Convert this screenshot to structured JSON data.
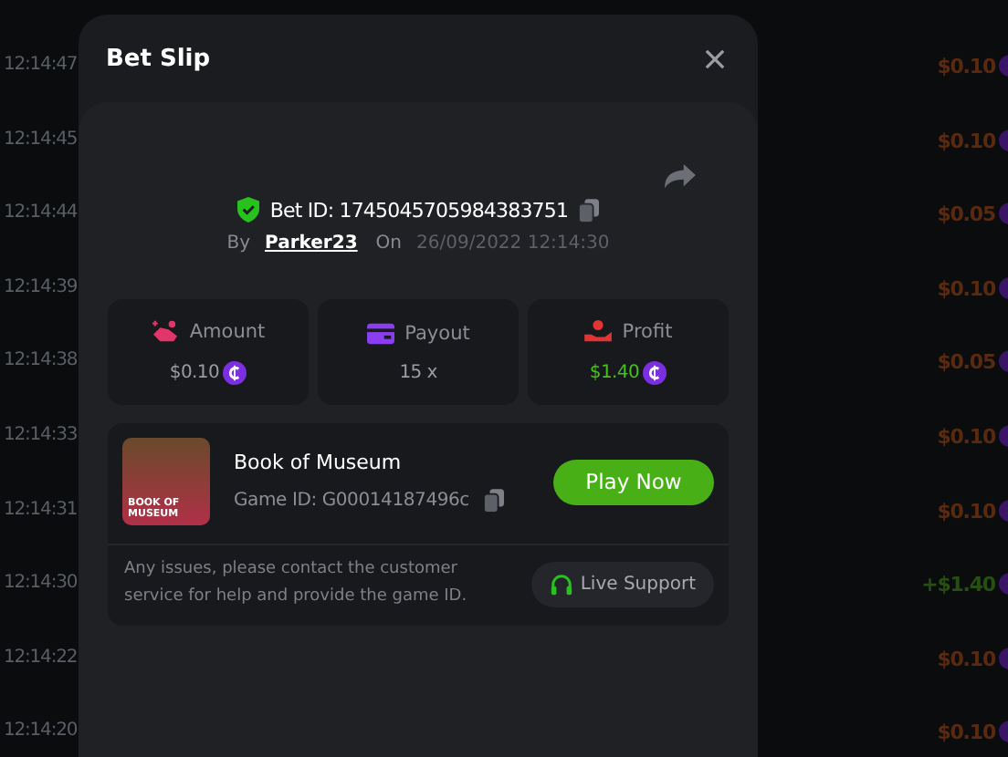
{
  "history": [
    {
      "time": "12:14:47",
      "amount": "$0.10",
      "kind": "loss"
    },
    {
      "time": "12:14:45",
      "amount": "$0.10",
      "kind": "loss"
    },
    {
      "time": "12:14:44",
      "amount": "$0.05",
      "kind": "loss"
    },
    {
      "time": "12:14:39",
      "amount": "$0.10",
      "kind": "loss"
    },
    {
      "time": "12:14:38",
      "amount": "$0.05",
      "kind": "loss"
    },
    {
      "time": "12:14:33",
      "amount": "$0.10",
      "kind": "loss"
    },
    {
      "time": "12:14:31",
      "amount": "$0.10",
      "kind": "loss"
    },
    {
      "time": "12:14:30",
      "amount": "+$1.40",
      "kind": "win"
    },
    {
      "time": "12:14:22",
      "amount": "$0.10",
      "kind": "loss"
    },
    {
      "time": "12:14:20",
      "amount": "$0.10",
      "kind": "loss"
    }
  ],
  "modal": {
    "title": "Bet Slip",
    "bet_id": "Bet ID: 1745045705984383751",
    "by_label": "By",
    "user": "Parker23",
    "on_label": "On",
    "date": "26/09/2022 12:14:30",
    "stats": [
      {
        "kind": "amount",
        "label": "Amount",
        "value": "$0.10",
        "coin": true
      },
      {
        "kind": "payout",
        "label": "Payout",
        "value": "15 x",
        "coin": false
      },
      {
        "kind": "profit",
        "label": "Profit",
        "value": "$1.40",
        "coin": true
      }
    ],
    "game": {
      "thumb_text": "BOOK OF MUSEUM",
      "name": "Book of Museum",
      "game_id": "Game ID: G00014187496c",
      "play": "Play Now"
    },
    "notice": "Any issues, please contact the customer service for help and provide the game ID.",
    "support": "Live Support"
  }
}
